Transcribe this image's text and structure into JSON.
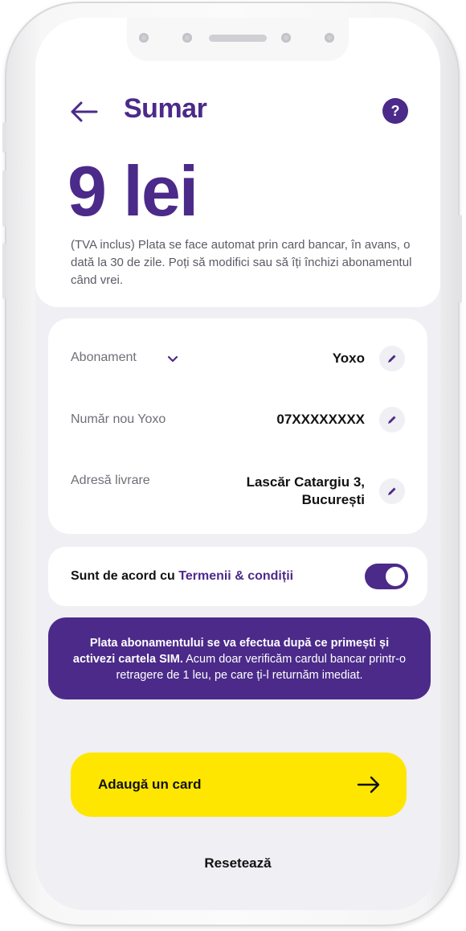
{
  "header": {
    "title": "Sumar",
    "help_label": "?"
  },
  "price": {
    "amount": "9 lei",
    "note": "(TVA inclus) Plata se face automat prin card bancar, în avans, o dată la 30 de zile. Poți să modifici sau să îți închizi abonamentul când vrei."
  },
  "details": {
    "subscription": {
      "label": "Abonament",
      "value": "Yoxo"
    },
    "number": {
      "label": "Număr nou Yoxo",
      "value": "07XXXXXXXX"
    },
    "address": {
      "label": "Adresă livrare",
      "value_line1": "Lascăr Catargiu 3,",
      "value_line2": "București"
    }
  },
  "terms": {
    "prefix": "Sunt de acord cu ",
    "link": "Termenii & condiții",
    "accepted": true
  },
  "info": {
    "bold": "Plata abonamentului se va efectua după ce primești și activezi cartela SIM.",
    "text": " Acum doar verificăm cardul bancar printr-o retragere de 1 leu, pe care ți-l returnăm imediat."
  },
  "actions": {
    "add_card_label": "Adaugă un card",
    "reset_label": "Resetează"
  },
  "colors": {
    "brand_purple": "#4b2a8a",
    "cta_yellow": "#ffe600",
    "background": "#efeff4"
  }
}
